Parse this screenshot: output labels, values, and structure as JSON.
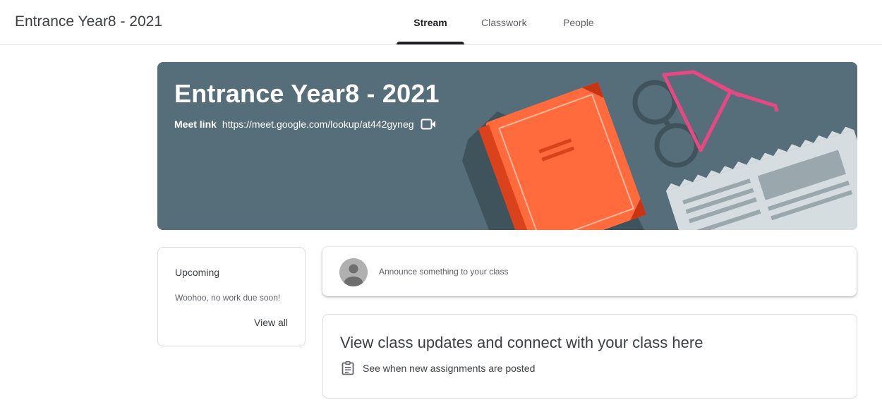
{
  "header": {
    "class_title": "Entrance Year8 - 2021",
    "tabs": [
      {
        "label": "Stream",
        "active": true
      },
      {
        "label": "Classwork",
        "active": false
      },
      {
        "label": "People",
        "active": false
      }
    ]
  },
  "banner": {
    "title": "Entrance Year8 - 2021",
    "meet_label": "Meet link",
    "meet_url": "https://meet.google.com/lookup/at442gyneg",
    "video_icon": "video-camera-icon",
    "background_color": "#566e7a"
  },
  "upcoming": {
    "title": "Upcoming",
    "empty_text": "Woohoo, no work due soon!",
    "view_all": "View all"
  },
  "announce": {
    "placeholder": "Announce something to your class",
    "avatar_icon": "default-avatar-icon"
  },
  "updates": {
    "title": "View class updates and connect with your class here",
    "item_text": "See when new assignments are posted",
    "item_icon": "assignment-icon"
  }
}
